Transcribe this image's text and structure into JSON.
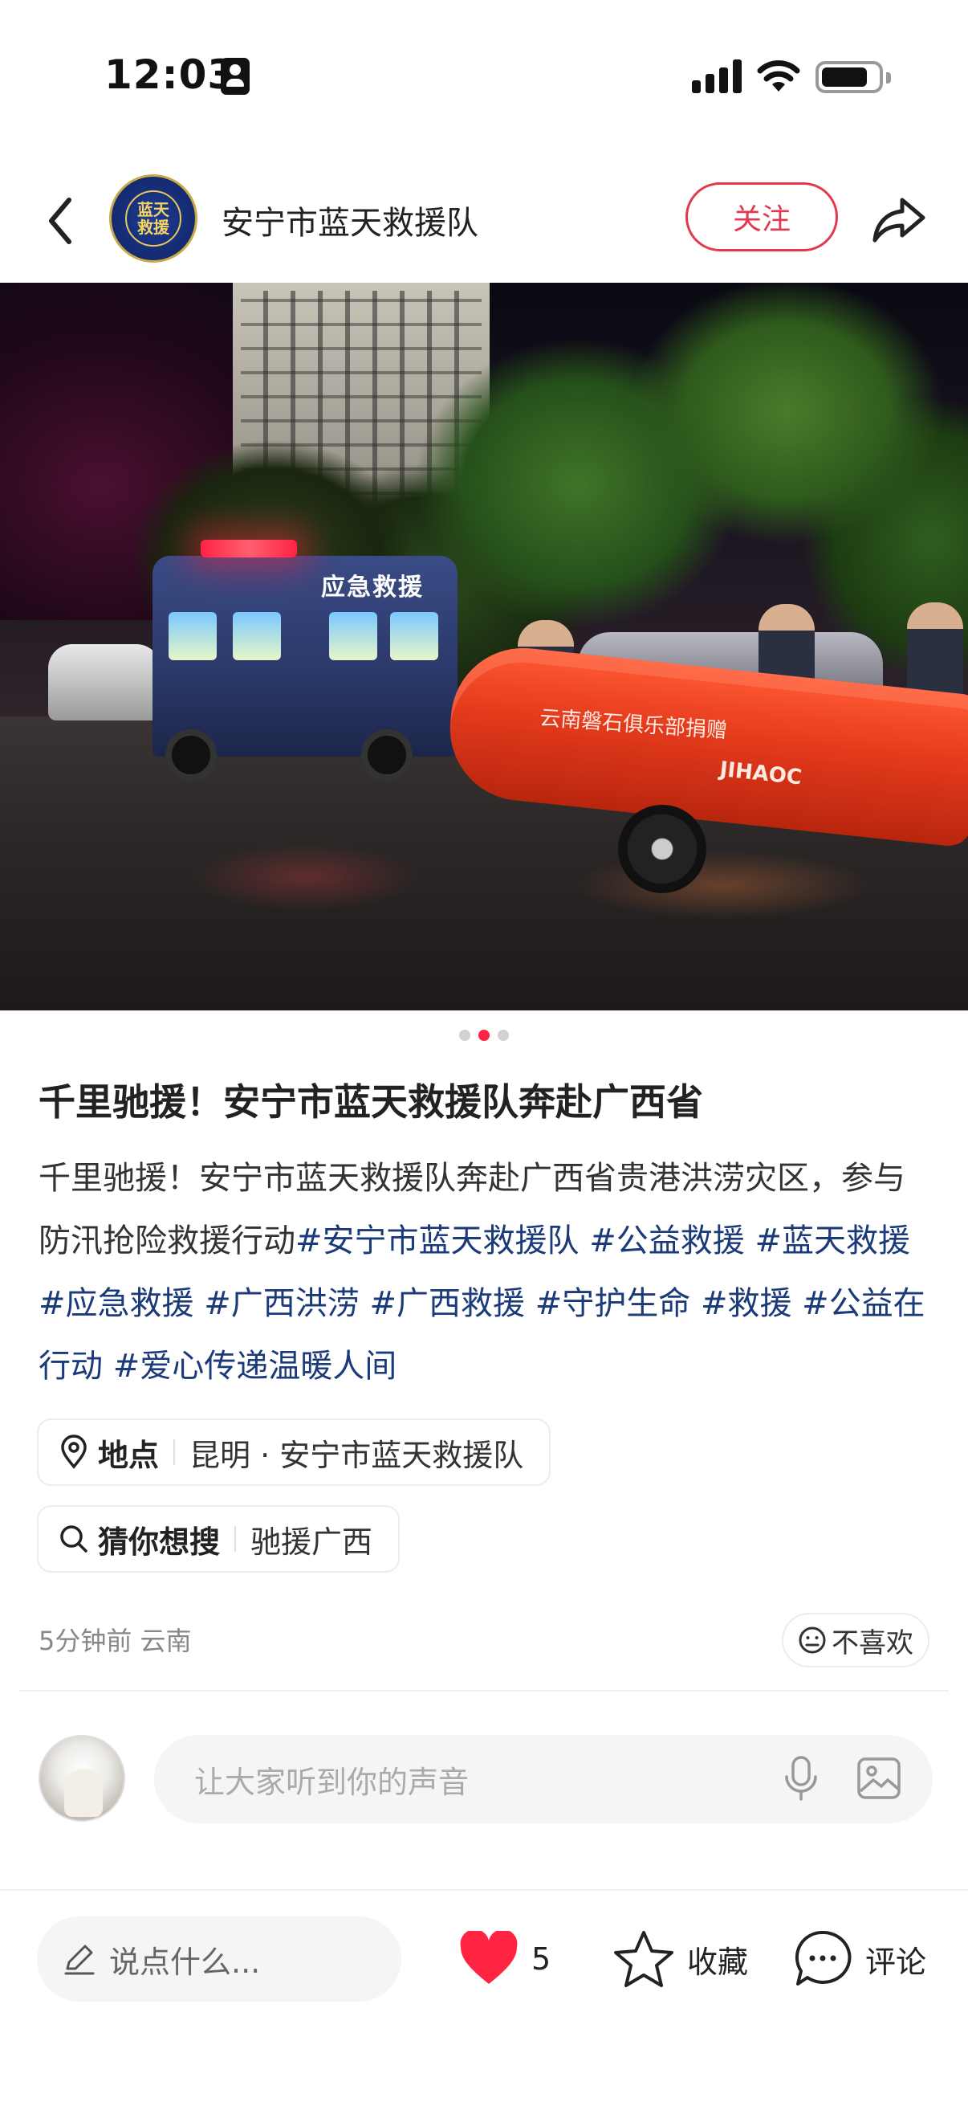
{
  "status_bar": {
    "time": "12:03"
  },
  "header": {
    "account_name": "安宁市蓝天救援队",
    "follow_label": "关注",
    "logo_text_top": "蓝天",
    "logo_text_bottom": "救援"
  },
  "photo": {
    "van_sign": "应急救援",
    "boat_text": "云南磐石俱乐部捐赠",
    "boat_brand": "JIHAOC"
  },
  "post": {
    "title": "千里驰援！安宁市蓝天救援队奔赴广西省",
    "body_text": "千里驰援！安宁市蓝天救援队奔赴广西省贵港洪涝灾区，参与防汛抢险救援行动",
    "tags": [
      "#安宁市蓝天救援队 ",
      "#公益救援 ",
      "#蓝天救援 ",
      "#应急救援 ",
      "#广西洪涝 ",
      "#广西救援 ",
      "#守护生命 ",
      "#救援 ",
      "#公益在行动 ",
      "#爱心传递温暖人间"
    ]
  },
  "location_chip": {
    "label": "地点",
    "value": "昆明 · 安宁市蓝天救援队"
  },
  "search_chip": {
    "label": "猜你想搜",
    "value": "驰援广西"
  },
  "meta": {
    "time_location": "5分钟前 云南",
    "dislike_label": "不喜欢"
  },
  "comment_box": {
    "placeholder": "让大家听到你的声音"
  },
  "bottom_bar": {
    "say_placeholder": "说点什么...",
    "like_count": "5",
    "collect_label": "收藏",
    "comment_label": "评论"
  },
  "pager": {
    "total": 3,
    "active_index": 2
  },
  "colors": {
    "accent": "#ff2442",
    "follow": "#e3394e",
    "tag": "#1b3a7a"
  }
}
